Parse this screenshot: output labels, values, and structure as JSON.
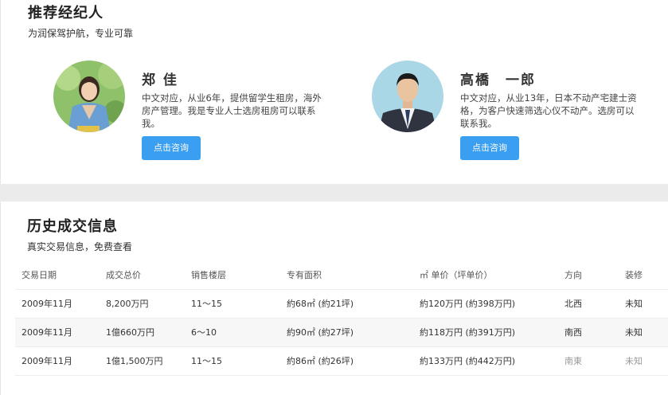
{
  "agents_section": {
    "title": "推荐经纪人",
    "subtitle": "为润保驾护航，专业可靠",
    "agents": [
      {
        "name": "郑 佳",
        "description": "中文对应，从业6年，提供留学生租房，海外房产管理。我是专业人士选房租房可以联系我。",
        "button_label": "点击咨询"
      },
      {
        "name": "高橋　一郎",
        "description": "中文对应，从业13年，日本不动产宅建士资格，为客户快速筛选心仪不动产。选房可以联系我。",
        "button_label": "点击咨询"
      }
    ]
  },
  "history_section": {
    "title": "历史成交信息",
    "subtitle": "真实交易信息，免费查看",
    "columns": [
      "交易日期",
      "成交总价",
      "销售楼层",
      "专有面积",
      "㎡ 单价（坪单价）",
      "方向",
      "装修"
    ],
    "rows": [
      [
        "2009年11月",
        "8,200万円",
        "11～15",
        "約68㎡ (約21坪)",
        "約120万円 (約398万円)",
        "北西",
        "未知"
      ],
      [
        "2009年11月",
        "1億660万円",
        "6～10",
        "約90㎡ (約27坪)",
        "約118万円 (約391万円)",
        "南西",
        "未知"
      ],
      [
        "2009年11月",
        "1億1,500万円",
        "11～15",
        "約86㎡ (約26坪)",
        "約133万円 (約442万円)",
        "南東",
        "未知"
      ]
    ]
  },
  "colors": {
    "accent_button": "#3a9ff0",
    "band_gray": "#ebebeb",
    "shaded_row": "#f7f7f7"
  }
}
